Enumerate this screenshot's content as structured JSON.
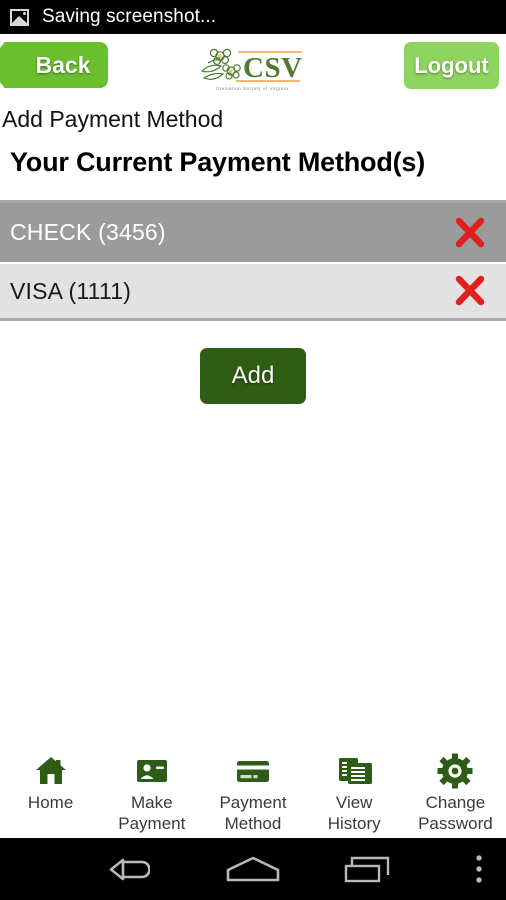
{
  "status_bar": {
    "icon": "image-icon",
    "text": "Saving screenshot..."
  },
  "header": {
    "back_label": "Back",
    "logout_label": "Logout",
    "logo": {
      "name": "csv-logo",
      "initials": "CSV",
      "tagline": "Cremation Society of Virginia"
    }
  },
  "page": {
    "subtitle": "Add Payment Method",
    "title": "Your Current Payment Method(s)"
  },
  "payment_methods": [
    {
      "label": "CHECK (3456)",
      "selected": true,
      "delete_icon": "red-x-icon"
    },
    {
      "label": "VISA (1111)",
      "selected": false,
      "delete_icon": "red-x-icon"
    }
  ],
  "actions": {
    "add_label": "Add"
  },
  "tab_bar": [
    {
      "label": "Home",
      "icon": "home-icon"
    },
    {
      "label": "Make\nPayment",
      "icon": "contact-card-icon"
    },
    {
      "label": "Payment\nMethod",
      "icon": "credit-card-icon"
    },
    {
      "label": "View\nHistory",
      "icon": "documents-icon"
    },
    {
      "label": "Change\nPassword",
      "icon": "gear-icon"
    }
  ],
  "android_nav": [
    {
      "name": "back-icon"
    },
    {
      "name": "home-icon"
    },
    {
      "name": "recent-apps-icon"
    },
    {
      "name": "overflow-menu-icon"
    }
  ],
  "colors": {
    "back_green": "#6abf2f",
    "logout_green": "#8ed35f",
    "add_green": "#2f5d14",
    "tab_icon_green": "#2e5c17",
    "row_selected": "#9b9b9b",
    "row_alt": "#e2e2e2",
    "delete_red": "#e02020"
  }
}
